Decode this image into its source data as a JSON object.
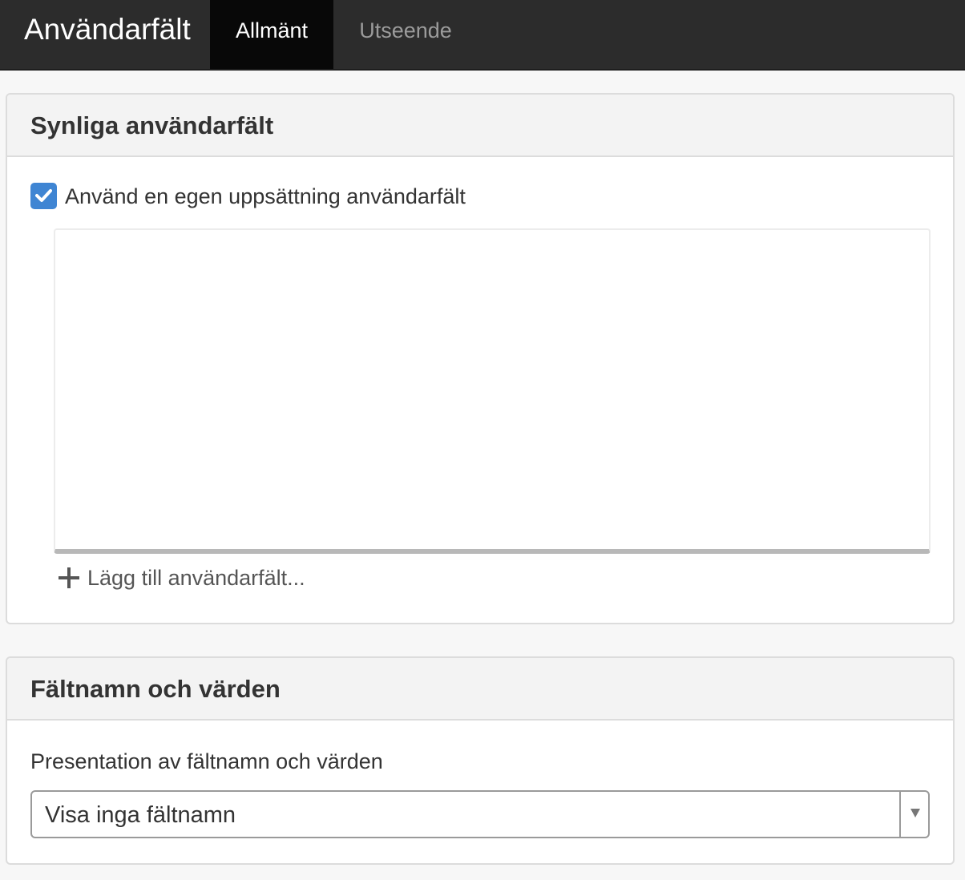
{
  "header": {
    "title": "Användarfält",
    "tabs": [
      {
        "label": "Allmänt",
        "active": true
      },
      {
        "label": "Utseende",
        "active": false
      }
    ]
  },
  "visible_fields_panel": {
    "title": "Synliga användarfält",
    "checkbox_label": "Använd en egen uppsättning användarfält",
    "checkbox_checked": true,
    "add_link_label": "Lägg till användarfält..."
  },
  "names_values_panel": {
    "title": "Fältnamn och värden",
    "select_label": "Presentation av fältnamn och värden",
    "select_value": "Visa inga fältnamn"
  },
  "colors": {
    "topbar": "#2c2c2c",
    "active_tab": "#080808",
    "checkbox": "#3f85d3"
  }
}
